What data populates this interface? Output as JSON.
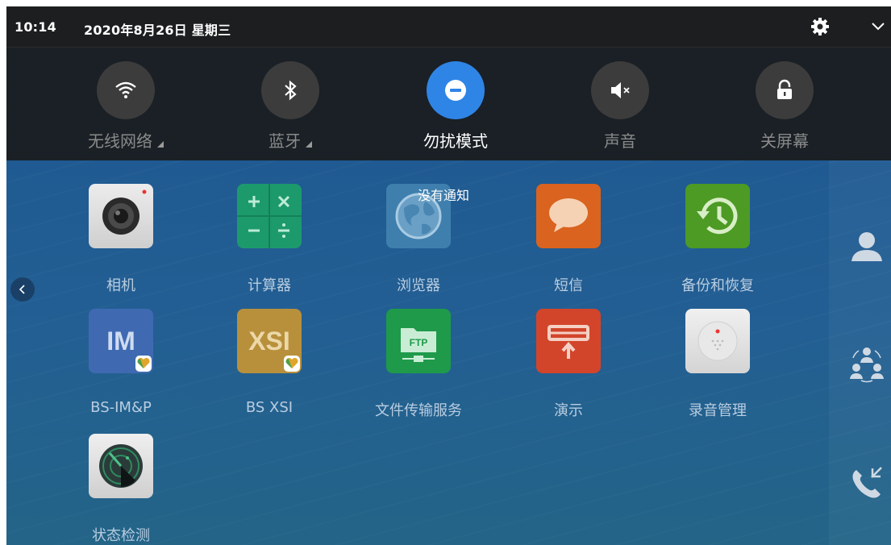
{
  "status_bar": {
    "time": "10:14",
    "date": "2020年8月26日 星期三",
    "icons": [
      "gear-icon",
      "chevron-down-icon"
    ]
  },
  "quick_settings": [
    {
      "label": "无线网络",
      "icon": "wifi-icon",
      "active": false,
      "has_dropdown": true
    },
    {
      "label": "蓝牙",
      "icon": "bluetooth-icon",
      "active": false,
      "has_dropdown": true
    },
    {
      "label": "勿扰模式",
      "icon": "do-not-disturb-icon",
      "active": true,
      "has_dropdown": false
    },
    {
      "label": "声音",
      "icon": "speaker-mute-icon",
      "active": false,
      "has_dropdown": false
    },
    {
      "label": "关屏幕",
      "icon": "padlock-icon",
      "active": false,
      "has_dropdown": false
    }
  ],
  "notifications": {
    "empty_text": "没有通知"
  },
  "apps": [
    {
      "label": "相机",
      "icon": "camera-icon"
    },
    {
      "label": "计算器",
      "icon": "calculator-icon"
    },
    {
      "label": "浏览器",
      "icon": "globe-icon"
    },
    {
      "label": "短信",
      "icon": "message-bubble-icon"
    },
    {
      "label": "备份和恢复",
      "icon": "backup-restore-icon"
    },
    {
      "label": "BS-IM&P",
      "icon": "im-icon",
      "icon_text": "IM"
    },
    {
      "label": "BS XSI",
      "icon": "xsi-icon",
      "icon_text": "XSI"
    },
    {
      "label": "文件传输服务",
      "icon": "ftp-folder-icon",
      "icon_text": "FTP"
    },
    {
      "label": "演示",
      "icon": "presentation-icon"
    },
    {
      "label": "录音管理",
      "icon": "recorder-icon"
    },
    {
      "label": "状态检测",
      "icon": "radar-icon"
    }
  ],
  "side": {
    "left_arrow": "chevron-left-icon",
    "dock": [
      "contact-icon",
      "group-icon",
      "call-transfer-icon"
    ]
  },
  "colors": {
    "accent": "#2f85e6",
    "shade": "#1a1a1a",
    "wallpaper": "#205b92"
  }
}
